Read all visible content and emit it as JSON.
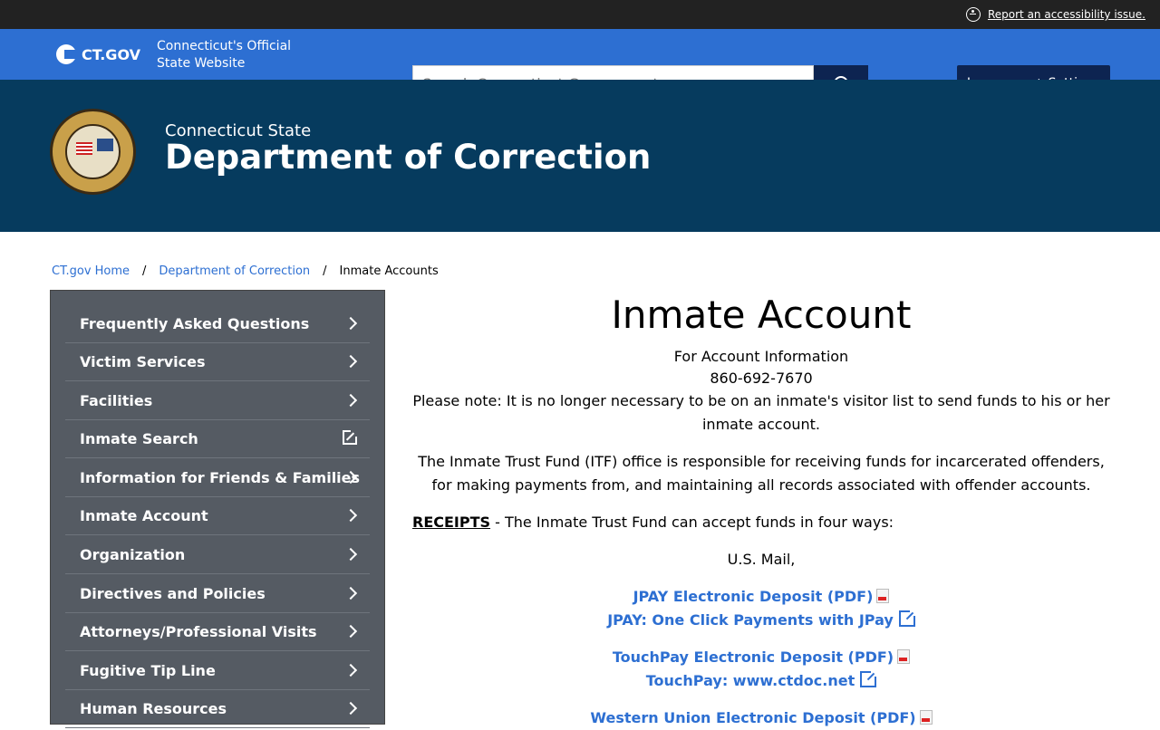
{
  "topbar": {
    "accessibility_link": "Report an accessibility issue."
  },
  "ctbar": {
    "logo_text": "CT.GOV",
    "tagline": "Connecticut's Official State Website",
    "search_placeholder": "Search Connecticut Government...",
    "language_button": "Language + Settings"
  },
  "agency": {
    "subtitle": "Connecticut State",
    "title": "Department of Correction"
  },
  "breadcrumb": {
    "home": "CT.gov Home",
    "dept": "Department of Correction",
    "current": "Inmate Accounts",
    "sep": "/"
  },
  "sidebar": {
    "items": [
      {
        "label": "Frequently Asked Questions"
      },
      {
        "label": "Victim Services"
      },
      {
        "label": "Facilities"
      },
      {
        "label": "Inmate Search"
      },
      {
        "label": "Information for Friends & Families"
      },
      {
        "label": "Inmate Account"
      },
      {
        "label": "Organization"
      },
      {
        "label": "Directives and Policies"
      },
      {
        "label": "Attorneys/Professional Visits"
      },
      {
        "label": "Fugitive Tip Line"
      },
      {
        "label": "Human Resources"
      }
    ]
  },
  "main": {
    "title": "Inmate Account",
    "account_info": "For Account Information",
    "phone": "860-692-7670",
    "note": "Please note: It is no longer necessary to be on an inmate's visitor list to send funds to his or her inmate account.",
    "itf_text": "The Inmate Trust Fund (ITF) office is responsible for receiving funds for incarcerated offenders, for making payments from, and maintaining all records associated with offender accounts.",
    "receipts_label": "RECEIPTS",
    "receipts_text": " - The Inmate Trust Fund can accept funds in four ways:",
    "mail": "U.S. Mail,",
    "links": {
      "jpay_pdf": "JPAY Electronic Deposit (PDF)",
      "jpay_one": "JPAY: One Click Payments with JPay",
      "touchpay_pdf": "TouchPay Electronic Deposit (PDF)",
      "touchpay_web": "TouchPay: www.ctdoc.net",
      "wu_pdf": "Western Union Electronic Deposit (PDF)"
    }
  }
}
